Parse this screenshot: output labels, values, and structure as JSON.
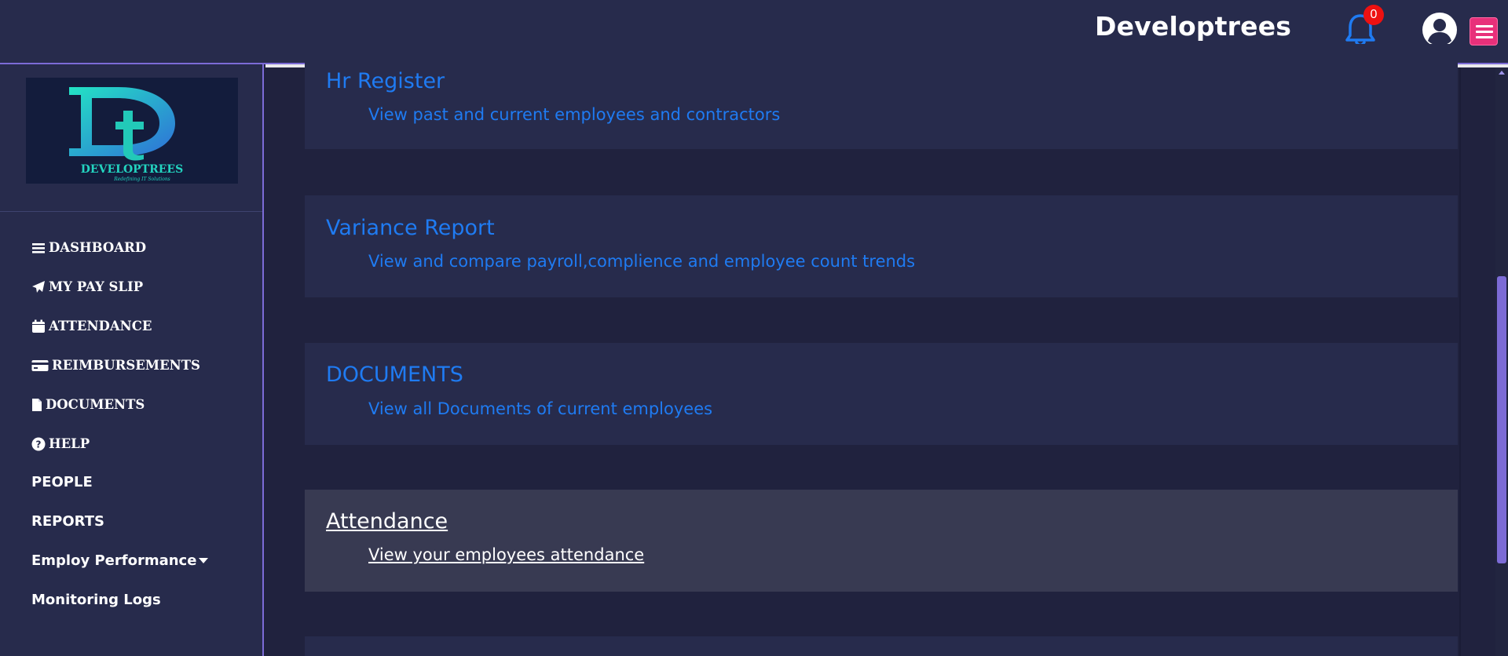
{
  "header": {
    "brand": "Developtrees",
    "notification_count": "0"
  },
  "sidebar": {
    "logo": {
      "letters": "Dt",
      "name": "DEVELOPTREES",
      "tagline": "Redefining IT Solutions"
    },
    "items": [
      {
        "label": "DASHBOARD",
        "icon": "bars-icon"
      },
      {
        "label": "MY PAY SLIP",
        "icon": "paper-plane-icon"
      },
      {
        "label": "ATTENDANCE",
        "icon": "calendar-icon"
      },
      {
        "label": "REIMBURSEMENTS",
        "icon": "credit-card-icon"
      },
      {
        "label": "DOCUMENTS",
        "icon": "file-icon"
      },
      {
        "label": "HELP",
        "icon": "question-circle-icon"
      },
      {
        "label": "PEOPLE"
      },
      {
        "label": "REPORTS"
      },
      {
        "label": "Employ Performance",
        "icon": "caret-down-icon"
      },
      {
        "label": "Monitoring Logs"
      }
    ]
  },
  "main": {
    "cards": [
      {
        "title": "Hr Register",
        "description": "View past and current employees and contractors"
      },
      {
        "title": "Variance Report",
        "description": "View and compare payroll,complience and employee count trends"
      },
      {
        "title": "DOCUMENTS",
        "description": "View all Documents of current employees"
      },
      {
        "title": "Attendance",
        "description": "View your employees attendance",
        "state": "hover"
      }
    ]
  },
  "colors": {
    "background": "#20223e",
    "panel": "#272b4c",
    "accent": "#7c6bd6",
    "link": "#1f7bf2",
    "menu_button": "#e8307a",
    "badge": "#ee1111"
  }
}
